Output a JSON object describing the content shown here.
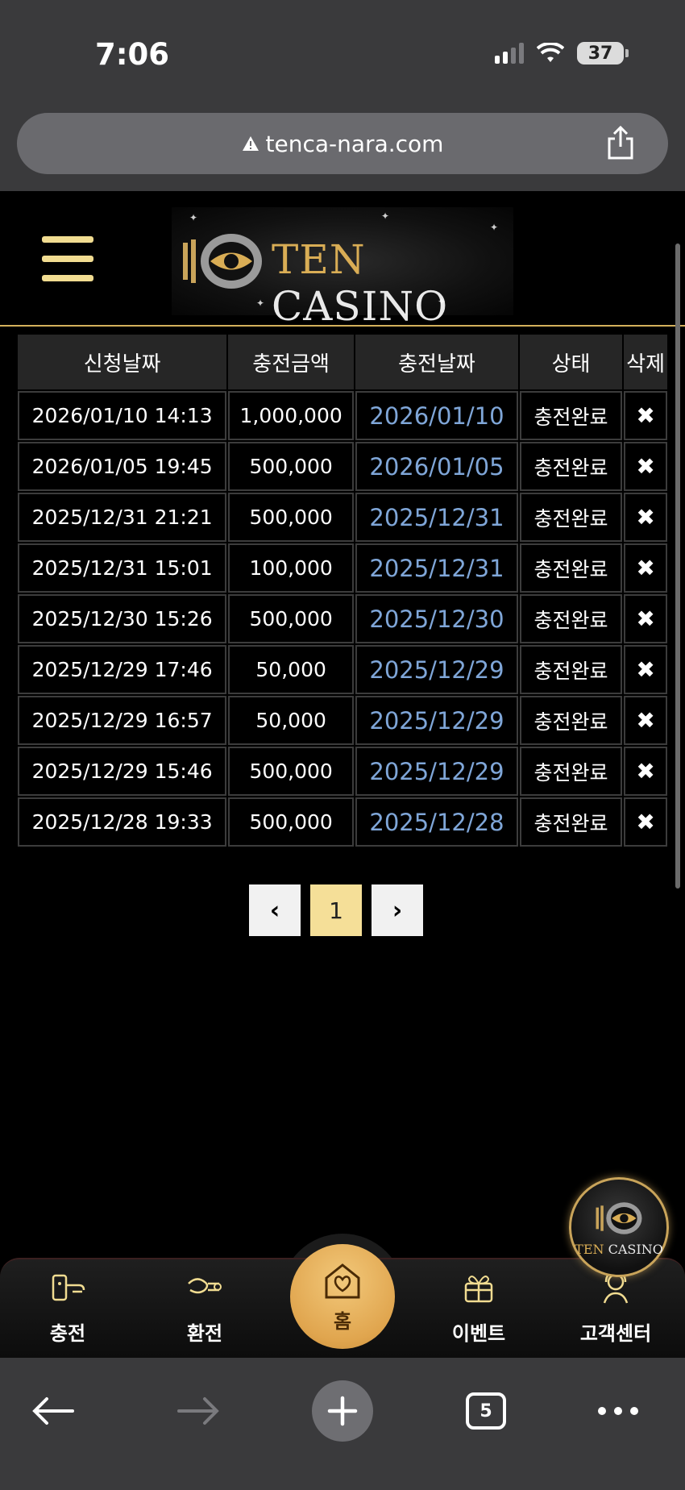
{
  "status_bar": {
    "time": "7:06",
    "battery": "37"
  },
  "browser": {
    "url": "tenca-nara.com",
    "tab_count": "5"
  },
  "site": {
    "logo_ten": "TEN",
    "logo_casino": "CASINO"
  },
  "table": {
    "headers": [
      "신청날짜",
      "충전금액",
      "충전날짜",
      "상태",
      "삭제"
    ],
    "rows": [
      {
        "request_date": "2026/01/10 14:13",
        "amount": "1,000,000",
        "charge_date": "2026/01/10",
        "status": "충전완료",
        "delete": "✖"
      },
      {
        "request_date": "2026/01/05 19:45",
        "amount": "500,000",
        "charge_date": "2026/01/05",
        "status": "충전완료",
        "delete": "✖"
      },
      {
        "request_date": "2025/12/31 21:21",
        "amount": "500,000",
        "charge_date": "2025/12/31",
        "status": "충전완료",
        "delete": "✖"
      },
      {
        "request_date": "2025/12/31 15:01",
        "amount": "100,000",
        "charge_date": "2025/12/31",
        "status": "충전완료",
        "delete": "✖"
      },
      {
        "request_date": "2025/12/30 15:26",
        "amount": "500,000",
        "charge_date": "2025/12/30",
        "status": "충전완료",
        "delete": "✖"
      },
      {
        "request_date": "2025/12/29 17:46",
        "amount": "50,000",
        "charge_date": "2025/12/29",
        "status": "충전완료",
        "delete": "✖"
      },
      {
        "request_date": "2025/12/29 16:57",
        "amount": "50,000",
        "charge_date": "2025/12/29",
        "status": "충전완료",
        "delete": "✖"
      },
      {
        "request_date": "2025/12/29 15:46",
        "amount": "500,000",
        "charge_date": "2025/12/29",
        "status": "충전완료",
        "delete": "✖"
      },
      {
        "request_date": "2025/12/28 19:33",
        "amount": "500,000",
        "charge_date": "2025/12/28",
        "status": "충전완료",
        "delete": "✖"
      }
    ]
  },
  "pagination": {
    "prev": "‹",
    "current": "1",
    "next": "›"
  },
  "bottom_nav": {
    "charge": "충전",
    "exchange": "환전",
    "home": "홈",
    "event": "이벤트",
    "support": "고객센터"
  },
  "colors": {
    "accent_gold": "#f1dc91",
    "link_blue": "#7fa6d8",
    "home_orange": "#e0a54e"
  }
}
